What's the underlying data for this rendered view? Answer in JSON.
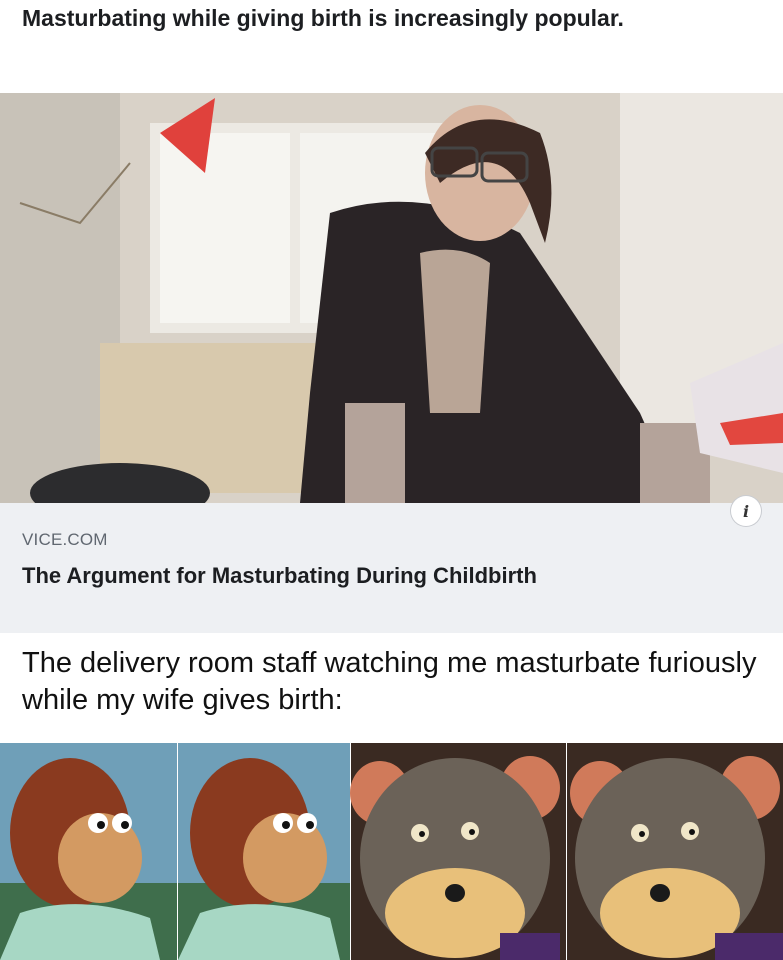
{
  "post": {
    "text": "Masturbating while giving birth is increasingly popular."
  },
  "link_card": {
    "domain": "VICE.COM",
    "title": "The Argument for Masturbating During Childbirth",
    "info_icon": "info-icon"
  },
  "meme": {
    "caption": "The delivery room staff watching me masturbate furiously while my wife gives birth:"
  },
  "colors": {
    "card_bg": "#eef0f3",
    "domain_text": "#606770",
    "title_text": "#1c1e21"
  }
}
